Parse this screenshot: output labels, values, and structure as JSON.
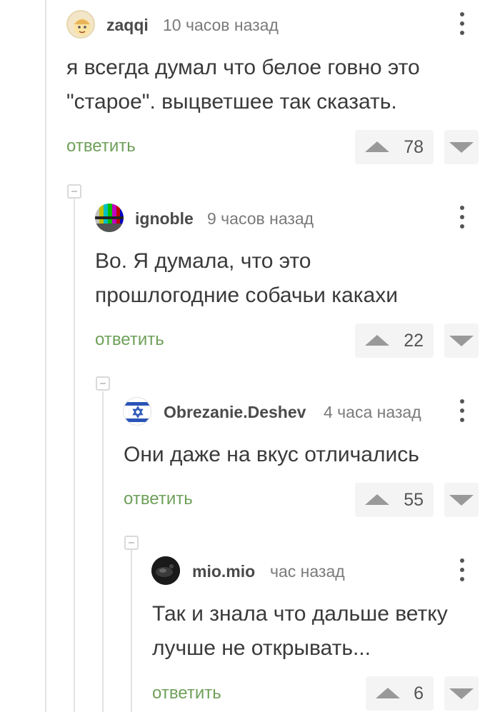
{
  "comments": [
    {
      "username": "zaqqi",
      "time": "10 часов назад",
      "text": "я всегда думал что белое говно это \"старое\". выцветшее так сказать.",
      "reply": "ответить",
      "rating": "78",
      "avatar_icon": "cartoon-face-avatar"
    },
    {
      "username": "ignoble",
      "time": "9 часов назад",
      "text": "Во. Я думала, что это прошлогодние собачьи какахи",
      "reply": "ответить",
      "rating": "22",
      "avatar_icon": "tv-test-pattern-avatar"
    },
    {
      "username": "Obrezanie.Deshev",
      "time": "4 часа назад",
      "text": "Они даже на вкус отличались",
      "reply": "ответить",
      "rating": "55",
      "avatar_icon": "israel-flag-avatar"
    },
    {
      "username": "mio.mio",
      "time": "час назад",
      "text": "Так и знала что дальше ветку лучше не открывать...",
      "reply": "ответить",
      "rating": "6",
      "avatar_icon": "dark-photo-avatar"
    }
  ],
  "colors": {
    "reply_link": "#6fa05a",
    "thread_line": "#e3e3e3",
    "vote_bg": "#f4f4f4"
  }
}
